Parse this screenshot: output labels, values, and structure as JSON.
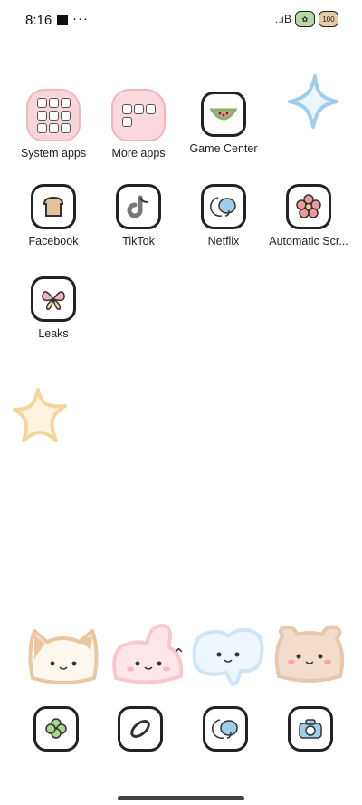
{
  "status": {
    "time": "8:16",
    "more": "···",
    "battery": "100"
  },
  "apps": [
    {
      "label": "System apps"
    },
    {
      "label": "More apps"
    },
    {
      "label": "Game Center"
    },
    {
      "label": "Facebook"
    },
    {
      "label": "TikTok"
    },
    {
      "label": "Netflix"
    },
    {
      "label": "Automatic Scr..."
    },
    {
      "label": "Leaks"
    }
  ],
  "colors": {
    "star_blue": "#9fcdea",
    "star_yellow": "#f4d69c",
    "cat": "#e9c7a2",
    "bunny": "#f7c9cf",
    "elephant": "#cfe4f7",
    "bear": "#e6c9ad"
  }
}
